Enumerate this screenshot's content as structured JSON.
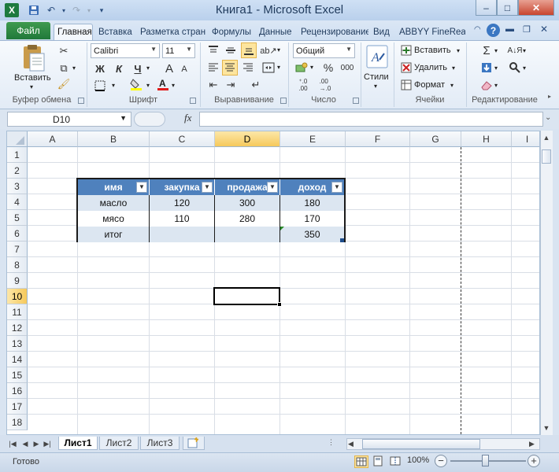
{
  "window": {
    "title": "Книга1  -  Microsoft Excel",
    "app_icon": "X",
    "minimize": "–",
    "maximize": "□",
    "close": "✕"
  },
  "ribbon": {
    "file_tab": "Файл",
    "tabs": [
      "Главная",
      "Вставка",
      "Разметка стран",
      "Формулы",
      "Данные",
      "Рецензирование",
      "Вид",
      "ABBYY FineReader"
    ],
    "clipboard": {
      "paste": "Вставить",
      "label": "Буфер обмена"
    },
    "font": {
      "name": "Calibri",
      "size": "11",
      "bold": "Ж",
      "italic": "К",
      "underline": "Ч",
      "grow": "A",
      "shrink": "A",
      "label": "Шрифт"
    },
    "alignment": {
      "label": "Выравнивание"
    },
    "number": {
      "format": "Общий",
      "percent": "%",
      "thousands": "000",
      "label": "Число"
    },
    "styles": {
      "button": "Стили"
    },
    "cells": {
      "insert": "Вставить",
      "delete": "Удалить",
      "format": "Формат",
      "label": "Ячейки"
    },
    "editing": {
      "sum": "Σ",
      "label": "Редактирование"
    }
  },
  "formula_bar": {
    "name_box": "D10",
    "fx": "fx",
    "value": ""
  },
  "grid": {
    "columns": [
      "A",
      "B",
      "C",
      "D",
      "E",
      "F",
      "G",
      "H",
      "I"
    ],
    "rows": [
      "1",
      "2",
      "3",
      "4",
      "5",
      "6",
      "7",
      "8",
      "9",
      "10",
      "11",
      "12",
      "13",
      "14",
      "15",
      "16",
      "17",
      "18"
    ],
    "selected_cell": "D10"
  },
  "table": {
    "headers": [
      "имя",
      "закупка",
      "продажа",
      "доход"
    ],
    "rows": [
      [
        "масло",
        "120",
        "300",
        "180"
      ],
      [
        "мясо",
        "110",
        "280",
        "170"
      ],
      [
        "итог",
        "",
        "",
        "350"
      ]
    ]
  },
  "sheets": [
    "Лист1",
    "Лист2",
    "Лист3"
  ],
  "status": {
    "ready": "Готово",
    "zoom": "100%",
    "minus": "−",
    "plus": "+"
  }
}
